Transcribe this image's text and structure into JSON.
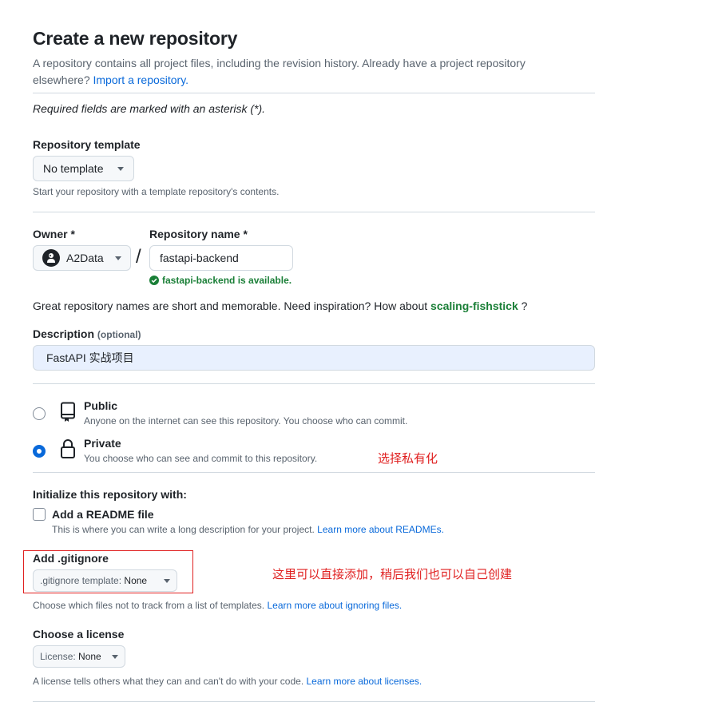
{
  "header": {
    "title": "Create a new repository",
    "intro_line1": "A repository contains all project files, including the revision history. Already have a project repository",
    "intro_line2_prefix": "elsewhere?",
    "import_link": "Import a repository.",
    "required_note": "Required fields are marked with an asterisk (*)."
  },
  "template": {
    "label": "Repository template",
    "button": "No template",
    "help": "Start your repository with a template repository's contents."
  },
  "owner": {
    "label": "Owner *",
    "value": "A2Data"
  },
  "repo_name": {
    "label": "Repository name *",
    "value": "fastapi-backend",
    "available": "fastapi-backend is available.",
    "separator": "/"
  },
  "suggestion": {
    "prefix": "Great repository names are short and memorable. Need inspiration? How about",
    "name": "scaling-fishstick",
    "suffix": "?"
  },
  "description": {
    "label": "Description",
    "optional": "(optional)",
    "value": "FastAPI 实战项目"
  },
  "visibility": {
    "public_title": "Public",
    "public_desc": "Anyone on the internet can see this repository. You choose who can commit.",
    "private_title": "Private",
    "private_desc": "You choose who can see and commit to this repository.",
    "selected": "private"
  },
  "initialize": {
    "label": "Initialize this repository with:",
    "readme_label": "Add a README file",
    "readme_desc": "This is where you can write a long description for your project.",
    "readme_link": "Learn more about READMEs.",
    "readme_checked": false
  },
  "gitignore": {
    "label": "Add .gitignore",
    "button_prefix": ".gitignore template:",
    "button_value": "None",
    "help": "Choose which files not to track from a list of templates.",
    "help_link": "Learn more about ignoring files."
  },
  "license": {
    "label": "Choose a license",
    "button_prefix": "License:",
    "button_value": "None",
    "help": "A license tells others what they can and can't do with your code.",
    "help_link": "Learn more about licenses."
  },
  "annotations": {
    "private_note": "选择私有化",
    "gitignore_note": "这里可以直接添加，稍后我们也可以自己创建"
  },
  "colors": {
    "link": "#0969da",
    "success": "#1a7f37",
    "annotation_red": "#e02020"
  }
}
